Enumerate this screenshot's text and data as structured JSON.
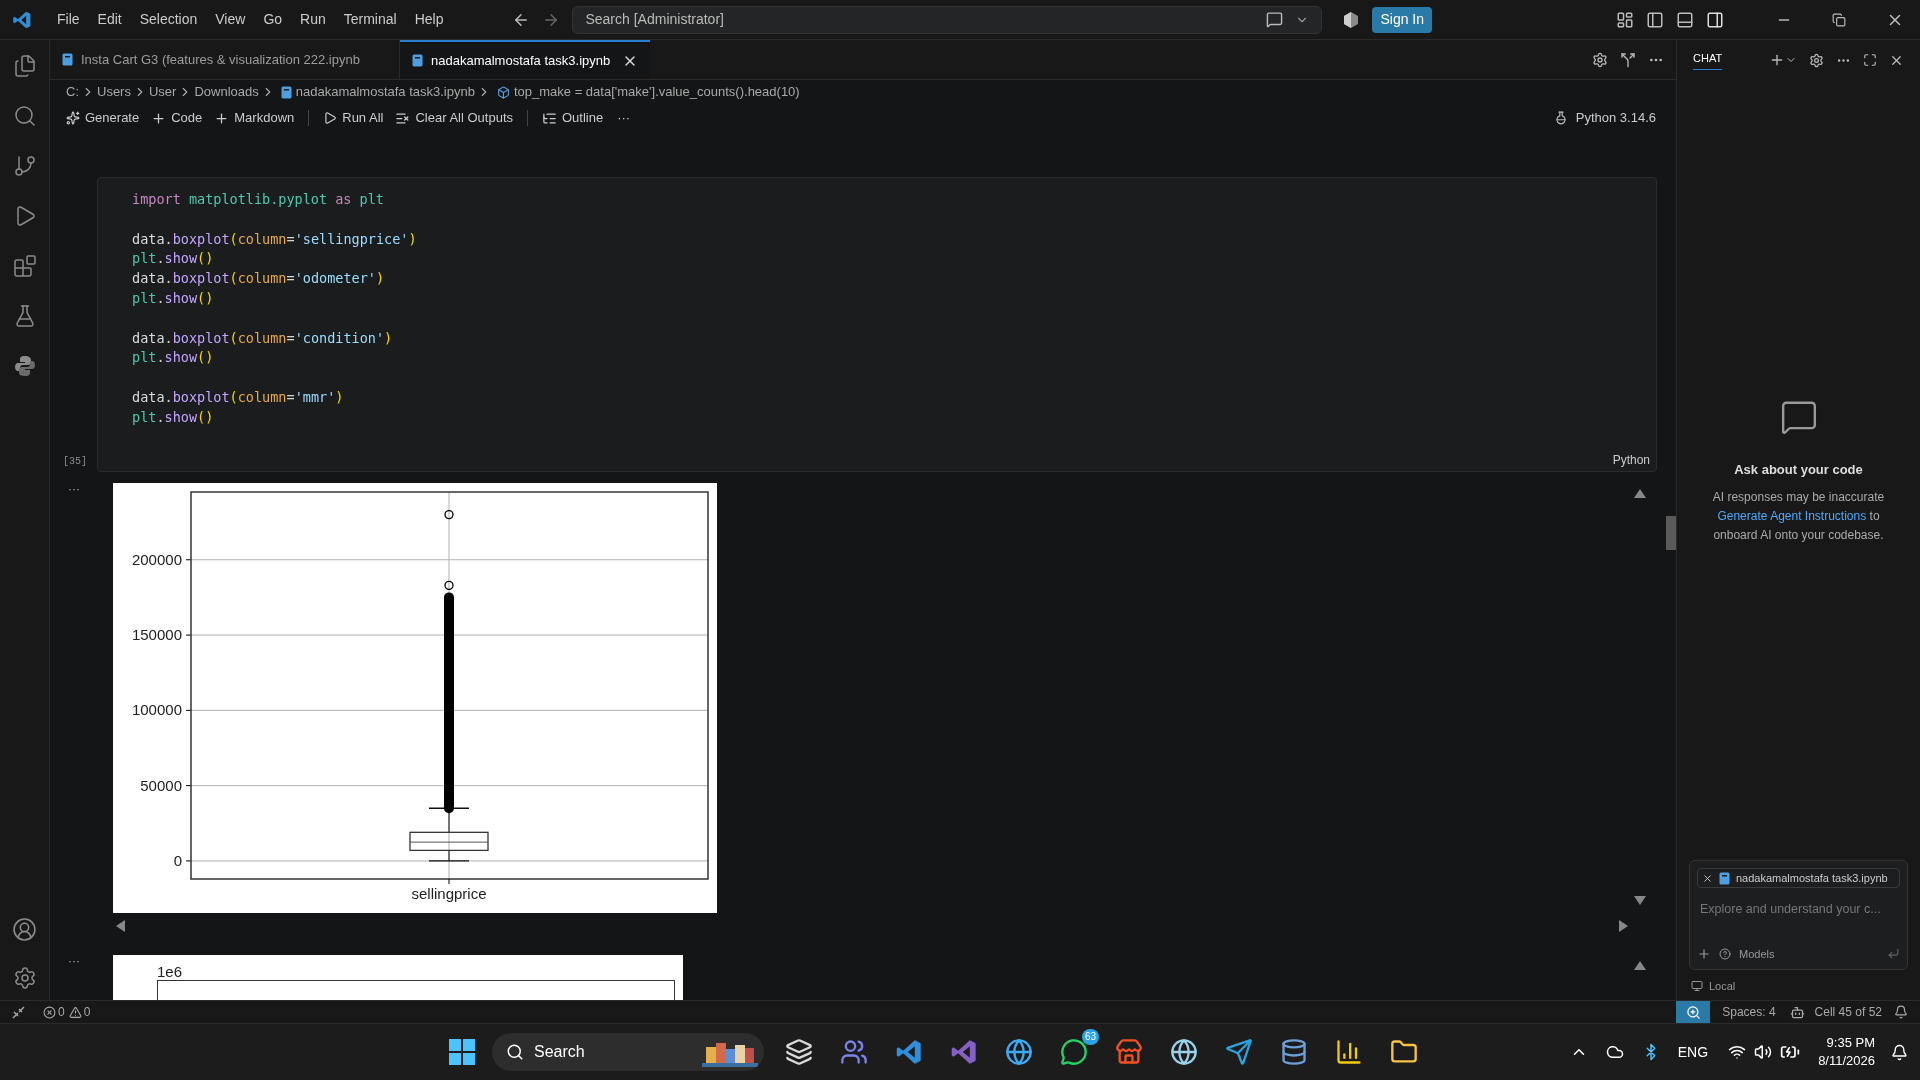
{
  "title_bar": {
    "menu": [
      "File",
      "Edit",
      "Selection",
      "View",
      "Go",
      "Run",
      "Terminal",
      "Help"
    ],
    "search": {
      "placeholder": "Search [Administrator]"
    },
    "sign_in": "Sign In"
  },
  "tabs": [
    {
      "label": "Insta Cart G3 (features & visualization 222.ipynb",
      "selected": false
    },
    {
      "label": "nadakamalmostafa task3.ipynb",
      "selected": true
    }
  ],
  "breadcrumb": [
    {
      "label": "C:",
      "kind": "folder"
    },
    {
      "label": "Users",
      "kind": "folder"
    },
    {
      "label": "User",
      "kind": "folder"
    },
    {
      "label": "Downloads",
      "kind": "folder"
    },
    {
      "label": "nadakamalmostafa task3.ipynb",
      "kind": "file"
    },
    {
      "label": "top_make = data['make'].value_counts().head(10)",
      "kind": "symbol"
    }
  ],
  "toolbar": {
    "actions": [
      {
        "label": "Generate",
        "kind": "sparkle"
      },
      {
        "label": "Code",
        "kind": "plus"
      },
      {
        "label": "Markdown",
        "kind": "plus"
      },
      {
        "label": "Run All",
        "kind": "run"
      },
      {
        "label": "Clear All Outputs",
        "kind": "clear"
      },
      {
        "label": "Outline",
        "kind": "outline"
      }
    ],
    "more": "···",
    "kernel": "Python 3.14.6"
  },
  "cell": {
    "execution_count": "[35]",
    "language": "Python",
    "blocks": [
      [
        [
          {
            "text": "import",
            "kind": "keyword"
          },
          {
            "text": " matplotlib.pyplot ",
            "kind": "module"
          },
          {
            "text": "as",
            "kind": "keyword"
          },
          {
            "text": " plt",
            "kind": "module"
          }
        ]
      ],
      [
        [
          {
            "text": "data",
            "kind": "var"
          },
          {
            "text": ".",
            "kind": "plain"
          },
          {
            "text": "boxplot",
            "kind": "func"
          },
          {
            "text": "(",
            "kind": "paren"
          },
          {
            "text": "column",
            "kind": "param"
          },
          {
            "text": "=",
            "kind": "plain"
          },
          {
            "text": "'sellingprice'",
            "kind": "string"
          },
          {
            "text": ")",
            "kind": "paren"
          }
        ],
        [
          {
            "text": "plt",
            "kind": "module"
          },
          {
            "text": ".",
            "kind": "plain"
          },
          {
            "text": "show",
            "kind": "func"
          },
          {
            "text": "()",
            "kind": "paren"
          }
        ],
        [
          {
            "text": "data",
            "kind": "var"
          },
          {
            "text": ".",
            "kind": "plain"
          },
          {
            "text": "boxplot",
            "kind": "func"
          },
          {
            "text": "(",
            "kind": "paren"
          },
          {
            "text": "column",
            "kind": "param"
          },
          {
            "text": "=",
            "kind": "plain"
          },
          {
            "text": "'odometer'",
            "kind": "string"
          },
          {
            "text": ")",
            "kind": "paren"
          }
        ],
        [
          {
            "text": "plt",
            "kind": "module"
          },
          {
            "text": ".",
            "kind": "plain"
          },
          {
            "text": "show",
            "kind": "func"
          },
          {
            "text": "()",
            "kind": "paren"
          }
        ]
      ],
      [
        [
          {
            "text": "data",
            "kind": "var"
          },
          {
            "text": ".",
            "kind": "plain"
          },
          {
            "text": "boxplot",
            "kind": "func"
          },
          {
            "text": "(",
            "kind": "paren"
          },
          {
            "text": "column",
            "kind": "param"
          },
          {
            "text": "=",
            "kind": "plain"
          },
          {
            "text": "'condition'",
            "kind": "string"
          },
          {
            "text": ")",
            "kind": "paren"
          }
        ],
        [
          {
            "text": "plt",
            "kind": "module"
          },
          {
            "text": ".",
            "kind": "plain"
          },
          {
            "text": "show",
            "kind": "func"
          },
          {
            "text": "()",
            "kind": "paren"
          }
        ]
      ],
      [
        [
          {
            "text": "data",
            "kind": "var"
          },
          {
            "text": ".",
            "kind": "plain"
          },
          {
            "text": "boxplot",
            "kind": "func"
          },
          {
            "text": "(",
            "kind": "paren"
          },
          {
            "text": "column",
            "kind": "param"
          },
          {
            "text": "=",
            "kind": "plain"
          },
          {
            "text": "'mmr'",
            "kind": "string"
          },
          {
            "text": ")",
            "kind": "paren"
          }
        ],
        [
          {
            "text": "plt",
            "kind": "module"
          },
          {
            "text": ".",
            "kind": "plain"
          },
          {
            "text": "show",
            "kind": "func"
          },
          {
            "text": "()",
            "kind": "paren"
          }
        ]
      ]
    ]
  },
  "output": {
    "more": "···",
    "box_plot": {
      "y_tick_labels": [
        "200000",
        "150000",
        "100000",
        "50000",
        "0"
      ],
      "category_label": "sellingprice"
    },
    "second_chart": {
      "offset_label": "1e6"
    }
  },
  "chat": {
    "tab": "CHAT",
    "heading": "Ask about your code",
    "note": "AI responses may be inaccurate",
    "link": "Generate Agent Instructions",
    "note_after": "to onboard AI onto your codebase.",
    "attachment": "nadakamalmostafa task3.ipynb",
    "input": {
      "placeholder": "Explore and understand your c..."
    },
    "models": "Models",
    "location": "Local"
  },
  "status_bar": {
    "errors": "0",
    "warnings": "0",
    "spaces": "Spaces: 4",
    "cell": "Cell 45 of 52"
  },
  "taskbar": {
    "search": "Search",
    "badge": "63",
    "language": "ENG",
    "time": "9:35 PM",
    "date": "8/11/2026"
  }
}
